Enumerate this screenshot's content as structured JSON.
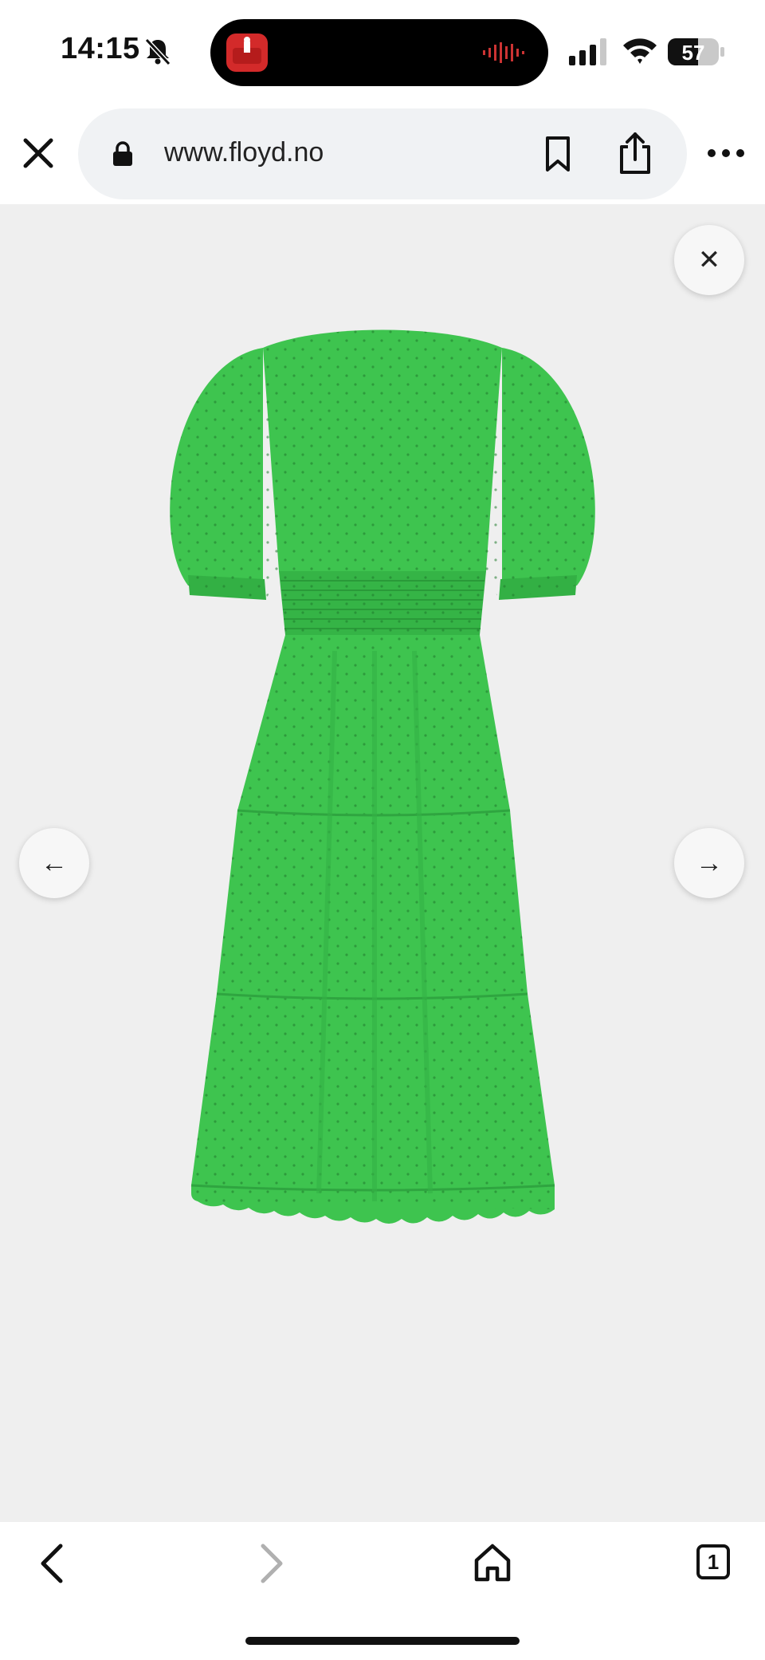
{
  "status_bar": {
    "time": "14:15",
    "battery_level": "57"
  },
  "browser": {
    "url": "www.floyd.no"
  },
  "viewer": {
    "prev_glyph": "←",
    "next_glyph": "→",
    "close_glyph": "✕",
    "image_subject": "green-eyelet-tiered-maxi-dress-back-view",
    "dress_color": "#3ec44f"
  },
  "toolbar": {
    "tab_count": "1"
  },
  "colors": {
    "viewer_background": "#efefef",
    "url_bar_background": "#f0f2f4",
    "dress": "#3ec44f",
    "dress_shadow": "#2fa540"
  }
}
